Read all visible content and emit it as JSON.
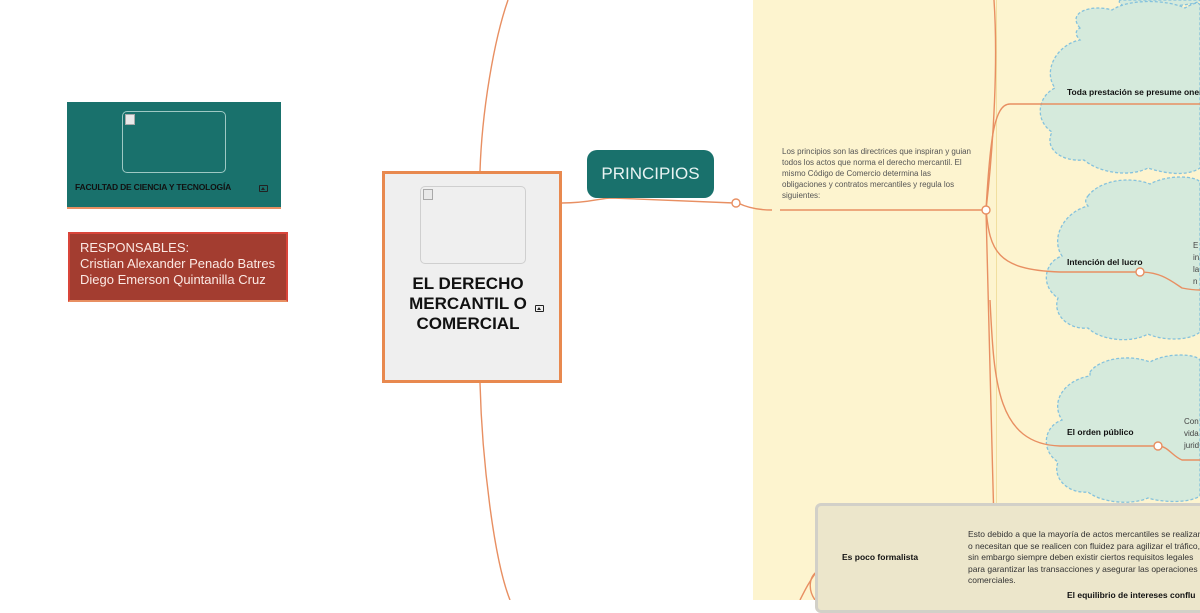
{
  "central_topic": {
    "title": "EL DERECHO MERCANTIL O COMERCIAL"
  },
  "facultad": {
    "label": "FACULTAD DE CIENCIA Y TECNOLOGÍA"
  },
  "responsables": {
    "heading": "RESPONSABLES:",
    "members": [
      "Cristian Alexander Penado Batres",
      "Diego Emerson Quintanilla Cruz"
    ]
  },
  "principios": {
    "label": "PRINCIPIOS",
    "intro": "Los principios son las directrices que inspiran y guian todos los actos que norma el derecho mercantil. El mismo Código de Comercio determina las obligaciones y contratos mercantiles y regula los siguientes:",
    "children": [
      {
        "label": "Toda prestación se presume onerosa",
        "side_text": []
      },
      {
        "label": "Intención del lucro",
        "side_text": [
          "E",
          "in",
          "la",
          "n"
        ]
      },
      {
        "label": "El orden público",
        "side_text": [
          "Con",
          "vida",
          "jurid"
        ]
      }
    ]
  },
  "formalismo": {
    "label": "Es poco formalista",
    "description": "Esto debido a que la mayoría de actos mercantiles se realizan o necesitan que se realicen con fluidez para agilizar el tráfico, sin embargo siempre deben existir ciertos requisitos legales para garantizar las transacciones y asegurar las operaciones comerciales."
  },
  "equilibrio": {
    "label": "El equilibrio de intereses conflu"
  },
  "colors": {
    "teal": "#19716c",
    "red": "#a33d30",
    "orange_connector": "#e88f62",
    "cloud_fill": "#d5eadc",
    "cloud_border": "#85c2dd",
    "yellow_panel": "#fdf4cf"
  }
}
